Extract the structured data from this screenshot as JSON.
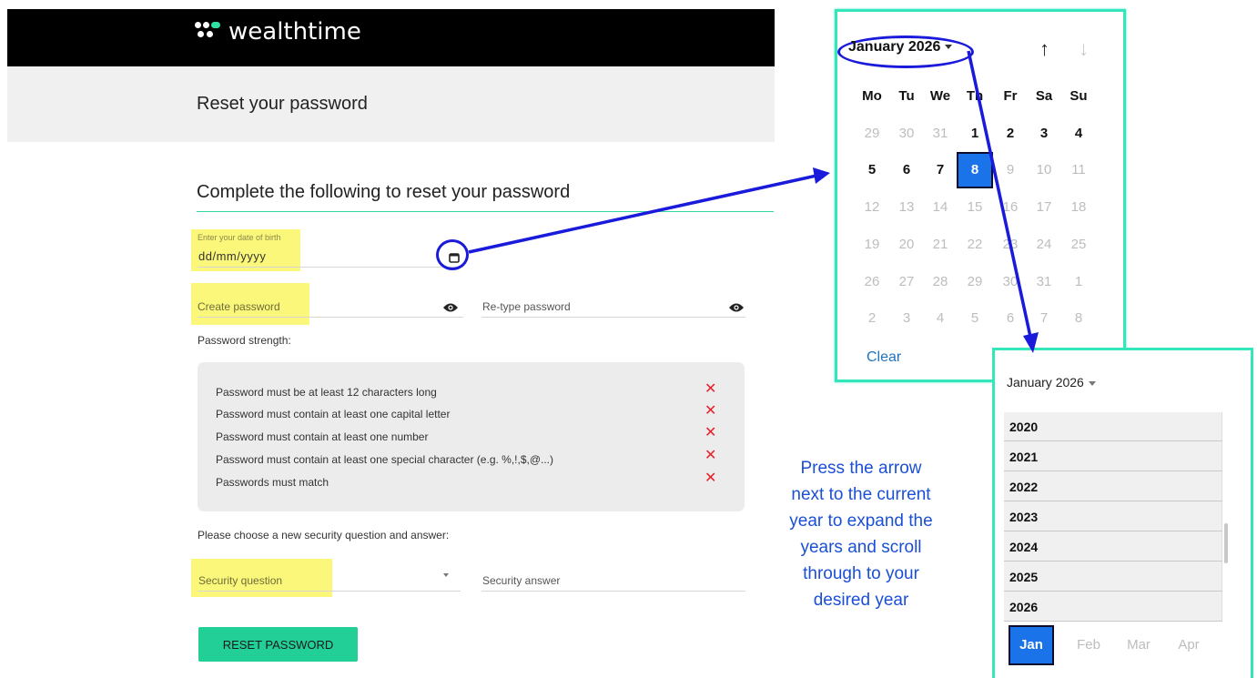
{
  "brand": {
    "name": "wealthtime"
  },
  "page": {
    "title": "Reset your password"
  },
  "form": {
    "section_title": "Complete the following to reset your password",
    "dob": {
      "label": "Enter your date of birth",
      "placeholder": "dd/mm/yyyy",
      "icon": "calendar-icon"
    },
    "create_password": {
      "placeholder": "Create password",
      "icon": "eye-icon"
    },
    "retype_password": {
      "placeholder": "Re-type password",
      "icon": "eye-icon"
    },
    "strength_label": "Password strength:",
    "rules": [
      "Password must be at least 12 characters long",
      "Password must contain at least one capital letter",
      "Password must contain at least one number",
      "Password must contain at least one special character (e.g. %,!,$,@...)",
      "Passwords must match"
    ],
    "rule_status_symbol": "✕",
    "rule_status_color": "#e8202a",
    "security_prompt": "Please choose a new security question and answer:",
    "security_question": {
      "placeholder": "Security question"
    },
    "security_answer": {
      "placeholder": "Security answer"
    },
    "submit_label": "RESET PASSWORD",
    "accent_color": "#22cf97",
    "highlight_color": "#fbf77a"
  },
  "calendar": {
    "month_label": "January 2026",
    "up_arrow": "↑",
    "down_arrow": "↓",
    "weekdays": [
      "Mo",
      "Tu",
      "We",
      "Th",
      "Fr",
      "Sa",
      "Su"
    ],
    "weeks": [
      [
        "29",
        "30",
        "31",
        "1",
        "2",
        "3",
        "4"
      ],
      [
        "5",
        "6",
        "7",
        "8",
        "9",
        "10",
        "11"
      ],
      [
        "12",
        "13",
        "14",
        "15",
        "16",
        "17",
        "18"
      ],
      [
        "19",
        "20",
        "21",
        "22",
        "23",
        "24",
        "25"
      ],
      [
        "26",
        "27",
        "28",
        "29",
        "30",
        "31",
        "1"
      ],
      [
        "2",
        "3",
        "4",
        "5",
        "6",
        "7",
        "8"
      ]
    ],
    "selected_day": "8",
    "clear_label": "Clear",
    "selected_color": "#1a73e8"
  },
  "year_picker": {
    "month_label": "January 2026",
    "years": [
      "2020",
      "2021",
      "2022",
      "2023",
      "2024",
      "2025",
      "2026"
    ],
    "months": [
      "Jan",
      "Feb",
      "Mar",
      "Apr"
    ],
    "selected_month": "Jan"
  },
  "annotation": {
    "instruction_lines": [
      "Press the arrow",
      "next to the current",
      "year to expand the",
      "years and scroll",
      "through to your",
      "desired year"
    ],
    "color": "#1a1adb",
    "panel_border_color": "#34e6bc"
  }
}
